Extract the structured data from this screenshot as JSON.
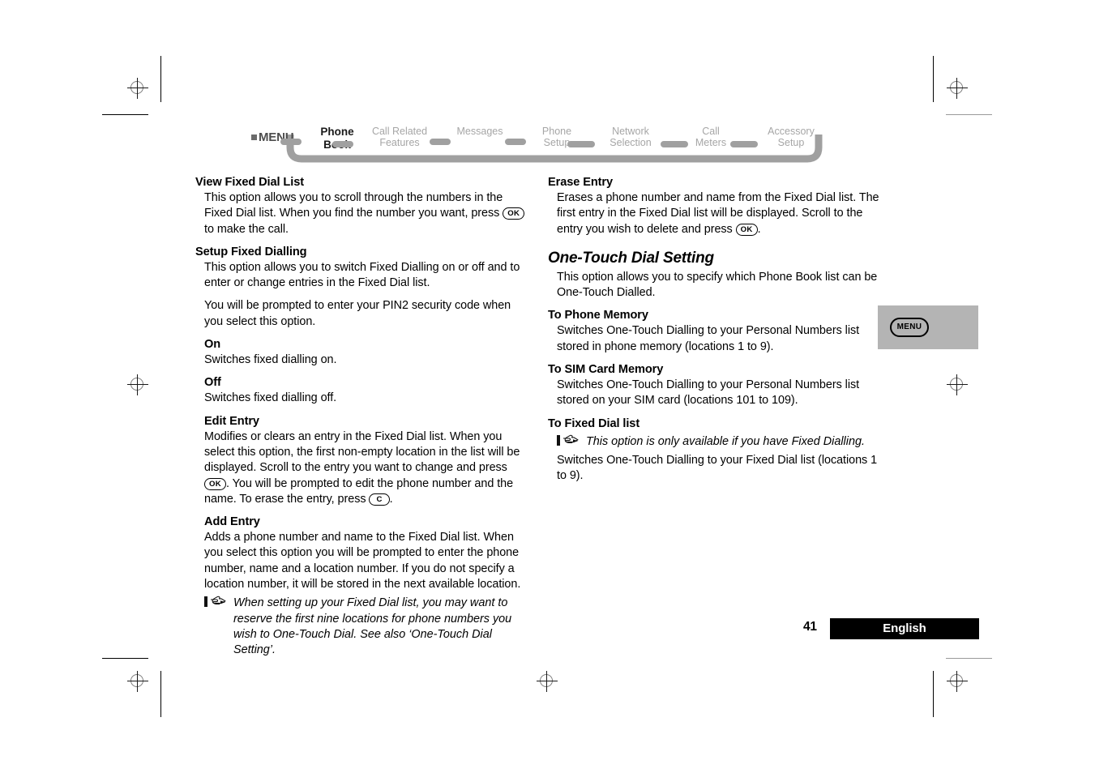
{
  "nav": {
    "menu_label": "MENU",
    "items": [
      {
        "line1": "Phone",
        "line2": "Book",
        "active": true
      },
      {
        "line1": "Call Related",
        "line2": "Features",
        "active": false
      },
      {
        "line1": "Messages",
        "line2": "",
        "active": false
      },
      {
        "line1": "Phone",
        "line2": "Setup",
        "active": false
      },
      {
        "line1": "Network",
        "line2": "Selection",
        "active": false
      },
      {
        "line1": "Call",
        "line2": "Meters",
        "active": false
      },
      {
        "line1": "Accessory",
        "line2": "Setup",
        "active": false
      }
    ]
  },
  "left_column": {
    "view_fixed_dial_list": {
      "heading": "View Fixed Dial List",
      "para_a": "This option allows you to scroll through the numbers in the Fixed Dial list. When you find the number you want, press ",
      "key_ok": "OK",
      "para_b": " to make the call."
    },
    "setup_fixed_dialling": {
      "heading": "Setup Fixed Dialling",
      "para1": "This option allows you to switch Fixed Dialling on or off and to enter or change entries in the Fixed Dial list.",
      "para2": "You will be prompted to enter your PIN2 security code when you select this option."
    },
    "on": {
      "heading": "On",
      "para": "Switches fixed dialling on."
    },
    "off": {
      "heading": "Off",
      "para": "Switches fixed dialling off."
    },
    "edit_entry": {
      "heading": "Edit Entry",
      "para_a": "Modifies or clears an entry in the Fixed Dial list. When you select this option, the first non-empty location in the list will be displayed. Scroll to the entry you want to change and press ",
      "key_ok": "OK",
      "para_b": ". You will be prompted to edit the phone number and the name. To erase the entry, press ",
      "key_c": "C",
      "para_c": "."
    },
    "add_entry": {
      "heading": "Add Entry",
      "para": "Adds a phone number and name to the Fixed Dial list. When you select this option you will be prompted to enter the phone number, name and a location number. If you do not specify a location number, it will be stored in the next available location.",
      "note": "When setting up your Fixed Dial list, you may want to reserve the first nine locations for phone numbers you wish to One-Touch Dial. See also ‘One-Touch Dial Setting’."
    }
  },
  "right_column": {
    "erase_entry": {
      "heading": "Erase Entry",
      "para_a": "Erases a phone number and name from the Fixed Dial list. The first entry in the Fixed Dial list will be displayed. Scroll to the entry you wish to delete and press ",
      "key_ok": "OK",
      "para_b": "."
    },
    "one_touch_dial_setting": {
      "heading": "One-Touch Dial Setting",
      "para": "This option allows you to specify which Phone Book list can be One-Touch Dialled."
    },
    "to_phone_memory": {
      "heading": "To Phone Memory",
      "para": "Switches One-Touch Dialling to your Personal Numbers list stored in phone memory (locations 1 to 9)."
    },
    "to_sim_card_memory": {
      "heading": "To SIM Card Memory",
      "para": "Switches One-Touch Dialling to your Personal Numbers list stored on your SIM card (locations 101 to 109)."
    },
    "to_fixed_dial_list": {
      "heading": "To Fixed Dial list",
      "note": "This option is only available if you have Fixed Dialling.",
      "para": "Switches One-Touch Dialling to your Fixed Dial list (locations 1 to 9)."
    }
  },
  "callout": {
    "menu_key_label": "MENU"
  },
  "footer": {
    "page_number": "41",
    "language": "English"
  },
  "colors": {
    "nav_inactive": "#a6a6a6",
    "nav_rail": "#a0a0a0",
    "callout_bg": "#b4b4b4",
    "footer_bar": "#000000"
  }
}
